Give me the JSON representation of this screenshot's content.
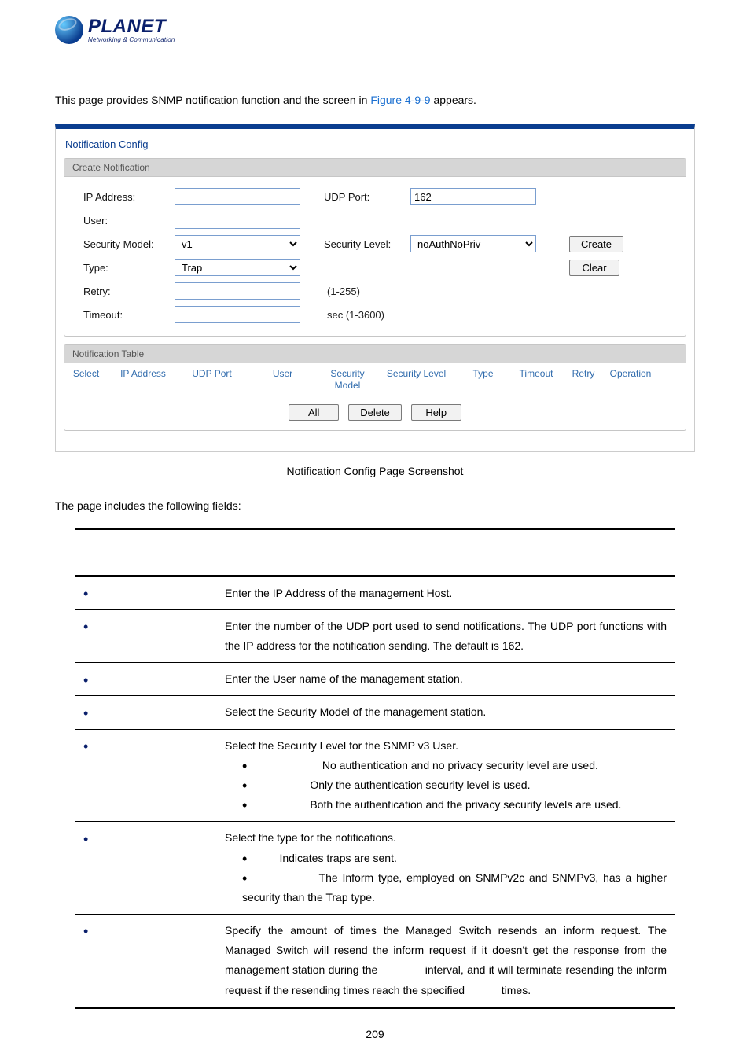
{
  "logo": {
    "name": "PLANET",
    "tagline": "Networking & Communication"
  },
  "intro": {
    "before": "This page provides SNMP notification function and the screen in ",
    "figref": "Figure 4-9-9",
    "after": " appears."
  },
  "panel": {
    "title": "Notification Config",
    "create": {
      "header": "Create Notification",
      "ip_label": "IP Address:",
      "ip_value": "",
      "udp_label": "UDP Port:",
      "udp_value": "162",
      "user_label": "User:",
      "user_value": "",
      "secmodel_label": "Security Model:",
      "secmodel_value": "v1",
      "seclevel_label": "Security Level:",
      "seclevel_value": "noAuthNoPriv",
      "type_label": "Type:",
      "type_value": "Trap",
      "retry_label": "Retry:",
      "retry_value": "",
      "retry_hint": "(1-255)",
      "timeout_label": "Timeout:",
      "timeout_value": "",
      "timeout_hint": "sec (1-3600)",
      "btn_create": "Create",
      "btn_clear": "Clear"
    },
    "table": {
      "header": "Notification Table",
      "cols": {
        "select": "Select",
        "ip": "IP Address",
        "udp": "UDP Port",
        "user": "User",
        "secmodel_l1": "Security",
        "secmodel_l2": "Model",
        "seclevel": "Security Level",
        "type": "Type",
        "timeout": "Timeout",
        "retry": "Retry",
        "operation": "Operation"
      },
      "btn_all": "All",
      "btn_delete": "Delete",
      "btn_help": "Help"
    }
  },
  "caption": "Notification Config Page Screenshot",
  "fields_intro": "The page includes the following fields:",
  "desc": {
    "rows": [
      {
        "desc": "Enter the IP Address of the management Host."
      },
      {
        "desc": "Enter the number of the UDP port used to send notifications. The UDP port functions with the IP address for the notification sending. The default is 162."
      },
      {
        "desc": "Enter the User name of the management station."
      },
      {
        "desc": "Select the Security Model of the management station."
      },
      {
        "desc": "Select the Security Level for the SNMP v3 User.",
        "subs": [
          "No authentication and no privacy security level are used.",
          "Only the authentication security level is used.",
          "Both the authentication and the privacy security levels are used."
        ]
      },
      {
        "desc": "Select the type for the notifications.",
        "subs": [
          "Indicates traps are sent.",
          "The Inform type, employed on SNMPv2c and SNMPv3, has a higher security than the Trap type."
        ]
      },
      {
        "desc_parts": {
          "p1": "Specify the amount of times the Managed Switch resends an inform request.   The Managed Switch will resend the inform request if it doesn't get the response from the management station during the ",
          "p2": " interval, and it will terminate resending the inform request if the resending times reach the specified ",
          "p3": " times."
        }
      }
    ]
  },
  "page_number": "209"
}
